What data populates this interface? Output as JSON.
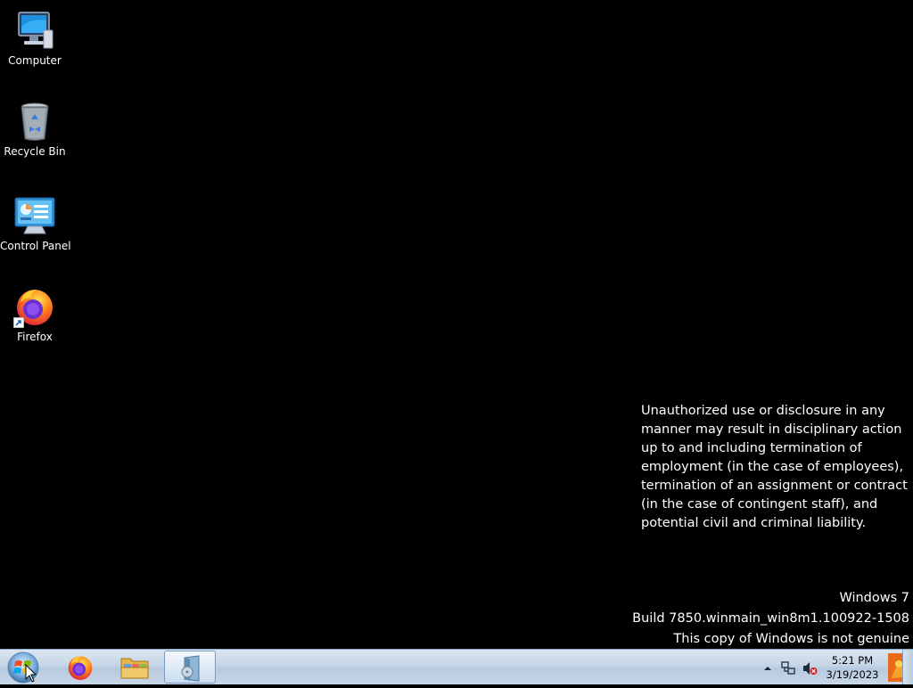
{
  "desktop": {
    "icons": [
      {
        "label": "Computer"
      },
      {
        "label": "Recycle Bin"
      },
      {
        "label": "Control Panel"
      },
      {
        "label": "Firefox"
      }
    ],
    "notice": "Unauthorized use or disclosure in any manner may result in disciplinary action up to and including termination of employment (in the case of employees), termination of an assignment or contract (in the case of contingent staff), and potential civil and criminal liability.",
    "watermark": {
      "os": "Windows 7",
      "build": "Build 7850.winmain_win8m1.100922-1508",
      "genuine": "This copy of Windows is not genuine"
    }
  },
  "taskbar": {
    "pinned": [
      {
        "icon": "firefox-icon"
      },
      {
        "icon": "file-explorer-icon"
      },
      {
        "icon": "media-player-icon",
        "active": true
      }
    ],
    "tray": {
      "time": "5:21 PM",
      "date": "3/19/2023",
      "icons": [
        "show-hidden-icons-arrow",
        "network-icon",
        "volume-muted-icon",
        "action-center-flag-icon"
      ]
    }
  },
  "colors": {
    "desktop_bg": "#000000",
    "taskbar_top": "#dbe6f1",
    "taskbar_bottom": "#b6c9de",
    "text": "#ffffff"
  }
}
